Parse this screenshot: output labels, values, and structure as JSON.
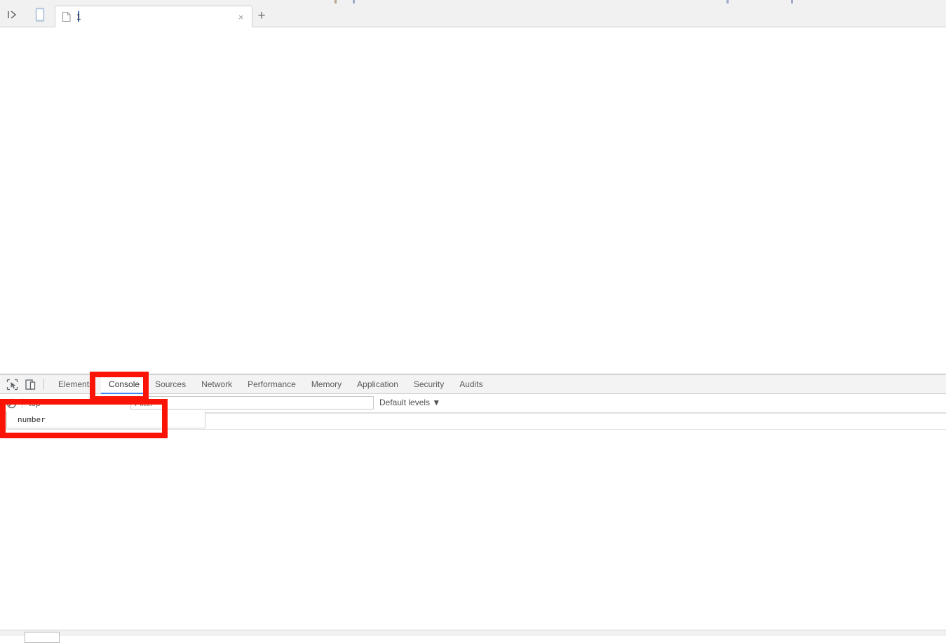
{
  "browser": {
    "nav_icon": "back-forward-icon",
    "device_icon": "mobile-device-icon",
    "new_tab_label": "+",
    "tabs": [
      {
        "title": "1",
        "favicon": "page-document-icon",
        "close_label": "×",
        "active": true
      }
    ]
  },
  "devtools": {
    "toolbar": {
      "inspect_icon": "inspect-element-cursor-icon",
      "device_toolbar_icon": "device-toolbar-icon"
    },
    "tabs": [
      {
        "label": "Elements",
        "active": false
      },
      {
        "label": "Console",
        "active": true
      },
      {
        "label": "Sources",
        "active": false
      },
      {
        "label": "Network",
        "active": false
      },
      {
        "label": "Performance",
        "active": false
      },
      {
        "label": "Memory",
        "active": false
      },
      {
        "label": "Application",
        "active": false
      },
      {
        "label": "Security",
        "active": false
      },
      {
        "label": "Audits",
        "active": false
      }
    ],
    "console": {
      "clear_icon": "clear-console-icon",
      "execution_context": "top",
      "filter_placeholder": "Filter",
      "filter_value": "",
      "log_levels_label": "Default levels",
      "log_levels_caret": "▼",
      "autocomplete": {
        "suggestions": [
          {
            "text": "number"
          }
        ]
      },
      "messages": []
    }
  },
  "annotations": {
    "color": "#fb1405",
    "stroke_px": 8,
    "boxes": [
      {
        "name": "console-tab-highlight",
        "target": "Console"
      },
      {
        "name": "autocomplete-highlight",
        "target": "number"
      }
    ]
  }
}
